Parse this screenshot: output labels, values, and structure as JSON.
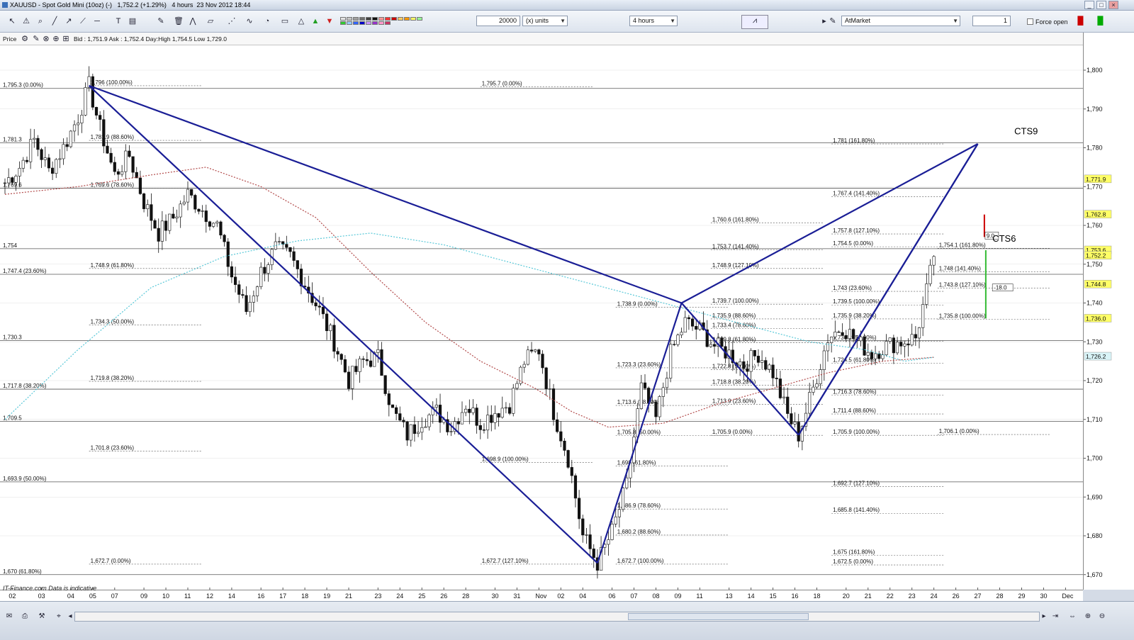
{
  "window": {
    "title": "XAUUSD - Spot Gold Mini (10oz) (-)   1,752.2 (+1.29%)   4 hours  23 Nov 2012 18:44"
  },
  "toolbar": {
    "quantity": "20000",
    "units": "(x) units",
    "timeframe": "4 hours",
    "order_type": "AtMarket",
    "lots": "1",
    "force_open": "Force open",
    "icons": [
      "cursor-icon",
      "alarm-icon",
      "zoom-icon",
      "line-icon",
      "ray-icon",
      "trendline-icon",
      "horizontal-line-icon",
      "text-icon",
      "fibonacci-icon",
      "tools-icon",
      "delete-icon",
      "buy-arrow-icon",
      "sell-arrow-icon"
    ],
    "colors": [
      "#e6e6e6",
      "#c8c8c8",
      "#a0a0a0",
      "#707070",
      "#404040",
      "#101010",
      "#ff9999",
      "#ff3333",
      "#cc0000",
      "#ffcc66",
      "#ff9900",
      "#ffff66",
      "#99ff99",
      "#33cc33",
      "#99ccff",
      "#3366ff",
      "#0000cc",
      "#cc99ff",
      "#9933cc",
      "#ff99cc",
      "#cc3366"
    ]
  },
  "infobar": {
    "price_label": "Price",
    "quote": "Bid : 1,751.9 Ask : 1,752.4 Day:High 1,754.5 Low 1,729.0"
  },
  "footer": {
    "source": "IT-Finance.com  Data is indicative"
  },
  "chart_data": {
    "type": "candlestick",
    "ylim": [
      1666,
      1808
    ],
    "y_ticks": [
      {
        "v": 1800,
        "label": "1,800"
      },
      {
        "v": 1790,
        "label": "1,790"
      },
      {
        "v": 1780,
        "label": "1,780"
      },
      {
        "v": 1770,
        "label": "1,770"
      },
      {
        "v": 1760,
        "label": "1,760"
      },
      {
        "v": 1750,
        "label": "1,750"
      },
      {
        "v": 1740,
        "label": "1,740"
      },
      {
        "v": 1730,
        "label": "1,730"
      },
      {
        "v": 1720,
        "label": "1,720"
      },
      {
        "v": 1710,
        "label": "1,710"
      },
      {
        "v": 1700,
        "label": "1,700"
      },
      {
        "v": 1690,
        "label": "1,690"
      },
      {
        "v": 1680,
        "label": "1,680"
      },
      {
        "v": 1670,
        "label": "1,670"
      }
    ],
    "date_ticks": [
      {
        "label": "02",
        "i": 2
      },
      {
        "label": "03",
        "i": 10
      },
      {
        "label": "04",
        "i": 18
      },
      {
        "label": "05",
        "i": 24
      },
      {
        "label": "07",
        "i": 30
      },
      {
        "label": "09",
        "i": 38
      },
      {
        "label": "10",
        "i": 44
      },
      {
        "label": "11",
        "i": 50
      },
      {
        "label": "12",
        "i": 56
      },
      {
        "label": "14",
        "i": 62
      },
      {
        "label": "16",
        "i": 70
      },
      {
        "label": "17",
        "i": 76
      },
      {
        "label": "18",
        "i": 82
      },
      {
        "label": "19",
        "i": 88
      },
      {
        "label": "21",
        "i": 94
      },
      {
        "label": "23",
        "i": 102
      },
      {
        "label": "24",
        "i": 108
      },
      {
        "label": "25",
        "i": 114
      },
      {
        "label": "26",
        "i": 120
      },
      {
        "label": "28",
        "i": 126
      },
      {
        "label": "30",
        "i": 134
      },
      {
        "label": "31",
        "i": 140
      },
      {
        "label": "Nov",
        "i": 146
      },
      {
        "label": "02",
        "i": 152
      },
      {
        "label": "04",
        "i": 158
      },
      {
        "label": "06",
        "i": 166
      },
      {
        "label": "07",
        "i": 172
      },
      {
        "label": "08",
        "i": 178
      },
      {
        "label": "09",
        "i": 184
      },
      {
        "label": "11",
        "i": 190
      },
      {
        "label": "13",
        "i": 198
      },
      {
        "label": "14",
        "i": 204
      },
      {
        "label": "15",
        "i": 210
      },
      {
        "label": "16",
        "i": 216
      },
      {
        "label": "18",
        "i": 222
      },
      {
        "label": "20",
        "i": 230
      },
      {
        "label": "21",
        "i": 236
      },
      {
        "label": "22",
        "i": 242
      },
      {
        "label": "23",
        "i": 248
      },
      {
        "label": "24",
        "i": 254
      },
      {
        "label": "26",
        "i": 260
      },
      {
        "label": "27",
        "i": 266
      },
      {
        "label": "28",
        "i": 272
      },
      {
        "label": "29",
        "i": 278
      },
      {
        "label": "30",
        "i": 284
      },
      {
        "label": "Dec",
        "i": 290
      }
    ],
    "n_slots": 296,
    "waypoints": [
      [
        0,
        1771
      ],
      [
        4,
        1775
      ],
      [
        8,
        1782
      ],
      [
        12,
        1774
      ],
      [
        16,
        1780
      ],
      [
        20,
        1788
      ],
      [
        23,
        1796
      ],
      [
        26,
        1785
      ],
      [
        30,
        1773
      ],
      [
        34,
        1778
      ],
      [
        38,
        1766
      ],
      [
        42,
        1758
      ],
      [
        46,
        1762
      ],
      [
        50,
        1768
      ],
      [
        54,
        1764
      ],
      [
        58,
        1760
      ],
      [
        62,
        1747
      ],
      [
        66,
        1738
      ],
      [
        70,
        1748
      ],
      [
        74,
        1754
      ],
      [
        78,
        1752
      ],
      [
        82,
        1745
      ],
      [
        86,
        1738
      ],
      [
        90,
        1730
      ],
      [
        94,
        1720
      ],
      [
        98,
        1725
      ],
      [
        102,
        1726
      ],
      [
        106,
        1712
      ],
      [
        110,
        1706
      ],
      [
        114,
        1710
      ],
      [
        118,
        1712
      ],
      [
        122,
        1708
      ],
      [
        126,
        1714
      ],
      [
        130,
        1709
      ],
      [
        134,
        1712
      ],
      [
        138,
        1714
      ],
      [
        142,
        1725
      ],
      [
        146,
        1728
      ],
      [
        150,
        1712
      ],
      [
        154,
        1700
      ],
      [
        158,
        1680
      ],
      [
        162,
        1673
      ],
      [
        166,
        1681
      ],
      [
        170,
        1693
      ],
      [
        174,
        1718
      ],
      [
        178,
        1710
      ],
      [
        182,
        1727
      ],
      [
        186,
        1735
      ],
      [
        190,
        1733
      ],
      [
        194,
        1729
      ],
      [
        198,
        1727
      ],
      [
        202,
        1724
      ],
      [
        206,
        1727
      ],
      [
        210,
        1722
      ],
      [
        214,
        1711
      ],
      [
        217,
        1706
      ],
      [
        221,
        1718
      ],
      [
        225,
        1731
      ],
      [
        229,
        1734
      ],
      [
        233,
        1730
      ],
      [
        237,
        1727
      ],
      [
        241,
        1729
      ],
      [
        245,
        1730
      ],
      [
        249,
        1731
      ],
      [
        252,
        1743
      ],
      [
        254,
        1752
      ]
    ],
    "candle_seed": 7,
    "series": [
      {
        "name": "moving-average-red",
        "color": "#b24a4a",
        "style": "dotted",
        "points": [
          [
            0,
            1768
          ],
          [
            20,
            1770
          ],
          [
            40,
            1773
          ],
          [
            55,
            1775
          ],
          [
            70,
            1770
          ],
          [
            85,
            1762
          ],
          [
            100,
            1748
          ],
          [
            115,
            1735
          ],
          [
            130,
            1725
          ],
          [
            145,
            1718
          ],
          [
            155,
            1712
          ],
          [
            165,
            1708
          ],
          [
            180,
            1709
          ],
          [
            195,
            1714
          ],
          [
            210,
            1718
          ],
          [
            225,
            1722
          ],
          [
            240,
            1725
          ],
          [
            254,
            1726
          ]
        ]
      },
      {
        "name": "moving-average-cyan",
        "color": "#58c8d8",
        "style": "dotted",
        "points": [
          [
            0,
            1710
          ],
          [
            20,
            1728
          ],
          [
            40,
            1744
          ],
          [
            60,
            1752
          ],
          [
            80,
            1756
          ],
          [
            100,
            1758
          ],
          [
            120,
            1755
          ],
          [
            140,
            1750
          ],
          [
            160,
            1745
          ],
          [
            180,
            1740
          ],
          [
            200,
            1735
          ],
          [
            220,
            1730
          ],
          [
            235,
            1728
          ],
          [
            246,
            1725
          ],
          [
            254,
            1726
          ]
        ]
      }
    ],
    "pattern_lines": [
      {
        "from": [
          23,
          1796
        ],
        "to": [
          185,
          1740
        ]
      },
      {
        "from": [
          23,
          1796
        ],
        "to": [
          162,
          1673
        ]
      },
      {
        "from": [
          162,
          1673
        ],
        "to": [
          185,
          1740
        ]
      },
      {
        "from": [
          185,
          1740
        ],
        "to": [
          217,
          1706
        ]
      },
      {
        "from": [
          217,
          1706
        ],
        "to": [
          266,
          1781
        ]
      },
      {
        "from": [
          185,
          1740
        ],
        "to": [
          266,
          1781
        ]
      },
      {
        "from": [
          217,
          1706
        ],
        "to": [
          266,
          1781
        ]
      }
    ],
    "horizontal_levels": [
      {
        "v": 1795.3,
        "label": "1,795.3 (0.00%)"
      },
      {
        "v": 1781.3,
        "label": "1,781.3"
      },
      {
        "v": 1769.6,
        "label": "1,769.6"
      },
      {
        "v": 1754,
        "label": "1,754"
      },
      {
        "v": 1747.4,
        "label": "1,747.4 (23.60%)"
      },
      {
        "v": 1730.3,
        "label": "1,730.3"
      },
      {
        "v": 1717.8,
        "label": "1,717.8 (38.20%)"
      },
      {
        "v": 1709.5,
        "label": "1,709.5"
      },
      {
        "v": 1693.9,
        "label": "1,693.9 (50.00%)"
      },
      {
        "v": 1670,
        "label": "1,670 (61.80%)"
      }
    ],
    "fib_labels": [
      {
        "i": 23,
        "v": 1796,
        "text": "1,796 (100.00%)"
      },
      {
        "i": 23,
        "v": 1781.9,
        "text": "1,781.9 (88.60%)"
      },
      {
        "i": 23,
        "v": 1769.6,
        "text": "1,769.6 (78.60%)"
      },
      {
        "i": 23,
        "v": 1748.9,
        "text": "1,748.9 (61.80%)"
      },
      {
        "i": 23,
        "v": 1734.3,
        "text": "1,734.3 (50.00%)"
      },
      {
        "i": 23,
        "v": 1719.8,
        "text": "1,719.8 (38.20%)"
      },
      {
        "i": 23,
        "v": 1701.8,
        "text": "1,701.8 (23.60%)"
      },
      {
        "i": 23,
        "v": 1672.7,
        "text": "1,672.7 (0.00%)"
      },
      {
        "i": 130,
        "v": 1795.7,
        "text": "1,795.7 (0.00%)"
      },
      {
        "i": 130,
        "v": 1698.9,
        "text": "1,698.9 (100.00%)"
      },
      {
        "i": 130,
        "v": 1672.7,
        "text": "1,672.7 (127.10%)"
      },
      {
        "i": 167,
        "v": 1738.9,
        "text": "1,738.9 (0.00%)"
      },
      {
        "i": 167,
        "v": 1723.3,
        "text": "1,723.3 (23.60%)"
      },
      {
        "i": 167,
        "v": 1713.6,
        "text": "1,713.6 (38.20%)"
      },
      {
        "i": 167,
        "v": 1705.8,
        "text": "1,705.8 (50.00%)"
      },
      {
        "i": 167,
        "v": 1698,
        "text": "1,698 (61.80%)"
      },
      {
        "i": 167,
        "v": 1686.9,
        "text": "1,686.9 (78.60%)"
      },
      {
        "i": 167,
        "v": 1680.2,
        "text": "1,680.2 (88.60%)"
      },
      {
        "i": 167,
        "v": 1672.7,
        "text": "1,672.7 (100.00%)"
      },
      {
        "i": 193,
        "v": 1760.6,
        "text": "1,760.6 (161.80%)"
      },
      {
        "i": 193,
        "v": 1753.7,
        "text": "1,753.7 (141.40%)"
      },
      {
        "i": 193,
        "v": 1748.9,
        "text": "1,748.9 (127.10%)"
      },
      {
        "i": 193,
        "v": 1739.7,
        "text": "1,739.7 (100.00%)"
      },
      {
        "i": 193,
        "v": 1735.9,
        "text": "1,735.9 (88.60%)"
      },
      {
        "i": 193,
        "v": 1733.4,
        "text": "1,733.4 (78.60%)"
      },
      {
        "i": 193,
        "v": 1729.8,
        "text": "1,729.8 (61.80%)"
      },
      {
        "i": 193,
        "v": 1722.8,
        "text": "1,722.8 (50.00%)"
      },
      {
        "i": 193,
        "v": 1718.8,
        "text": "1,718.8 (38.20%)"
      },
      {
        "i": 193,
        "v": 1713.9,
        "text": "1,713.9 (23.60%)"
      },
      {
        "i": 193,
        "v": 1705.9,
        "text": "1,705.9 (0.00%)"
      },
      {
        "i": 226,
        "v": 1781,
        "text": "1,781 (161.80%)"
      },
      {
        "i": 226,
        "v": 1767.4,
        "text": "1,767.4 (141.40%)"
      },
      {
        "i": 226,
        "v": 1757.8,
        "text": "1,757.8 (127.10%)"
      },
      {
        "i": 226,
        "v": 1754.5,
        "text": "1,754.5 (0.00%)"
      },
      {
        "i": 226,
        "v": 1743,
        "text": "1,743 (23.60%)"
      },
      {
        "i": 226,
        "v": 1739.5,
        "text": "1,739.5 (100.00%)"
      },
      {
        "i": 226,
        "v": 1735.9,
        "text": "1,735.9 (38.20%)"
      },
      {
        "i": 226,
        "v": 1730.2,
        "text": "1,730.2 (50.00%)"
      },
      {
        "i": 226,
        "v": 1724.5,
        "text": "1,724.5 (61.80%)"
      },
      {
        "i": 226,
        "v": 1716.3,
        "text": "1,716.3 (78.60%)"
      },
      {
        "i": 226,
        "v": 1711.4,
        "text": "1,711.4 (88.60%)"
      },
      {
        "i": 226,
        "v": 1705.9,
        "text": "1,705.9 (100.00%)"
      },
      {
        "i": 226,
        "v": 1692.7,
        "text": "1,692.7 (127.10%)"
      },
      {
        "i": 226,
        "v": 1685.8,
        "text": "1,685.8 (141.40%)"
      },
      {
        "i": 226,
        "v": 1675,
        "text": "1,675 (161.80%)"
      },
      {
        "i": 226,
        "v": 1672.5,
        "text": "1,672.5 (0.00%)"
      },
      {
        "i": 255,
        "v": 1754.1,
        "text": "1,754.1 (161.80%)"
      },
      {
        "i": 255,
        "v": 1748,
        "text": "1,748 (141.40%)"
      },
      {
        "i": 255,
        "v": 1743.8,
        "text": "1,743.8 (127.10%)"
      },
      {
        "i": 255,
        "v": 1735.8,
        "text": "1,735.8 (100.00%)"
      },
      {
        "i": 255,
        "v": 1706.1,
        "text": "1,706.1 (0.00%)"
      }
    ],
    "annotations": [
      {
        "text": "CTS9",
        "i": 276,
        "v": 1783.5
      },
      {
        "text": "CTS6",
        "i": 270,
        "v": 1755.8
      }
    ],
    "markers": [
      {
        "text": "9.0",
        "i": 268,
        "v": 1757.2
      },
      {
        "text": "-18.0",
        "i": 270,
        "v": 1743.8
      }
    ],
    "price_tags": [
      {
        "v": 1771.9,
        "label": "1,771.9",
        "bg": "#ffff66"
      },
      {
        "v": 1762.8,
        "label": "1,762.8",
        "bg": "#ffff66"
      },
      {
        "v": 1753.6,
        "label": "1,753.6",
        "bg": "#ffff66"
      },
      {
        "v": 1752.2,
        "label": "1,752.2",
        "bg": "#ffff66"
      },
      {
        "v": 1744.8,
        "label": "1,744.8",
        "bg": "#ffff66"
      },
      {
        "v": 1736,
        "label": "1,736.0",
        "bg": "#ffff66"
      },
      {
        "v": 1726.2,
        "label": "1,726.2",
        "bg": "#d9f4f8"
      }
    ]
  }
}
